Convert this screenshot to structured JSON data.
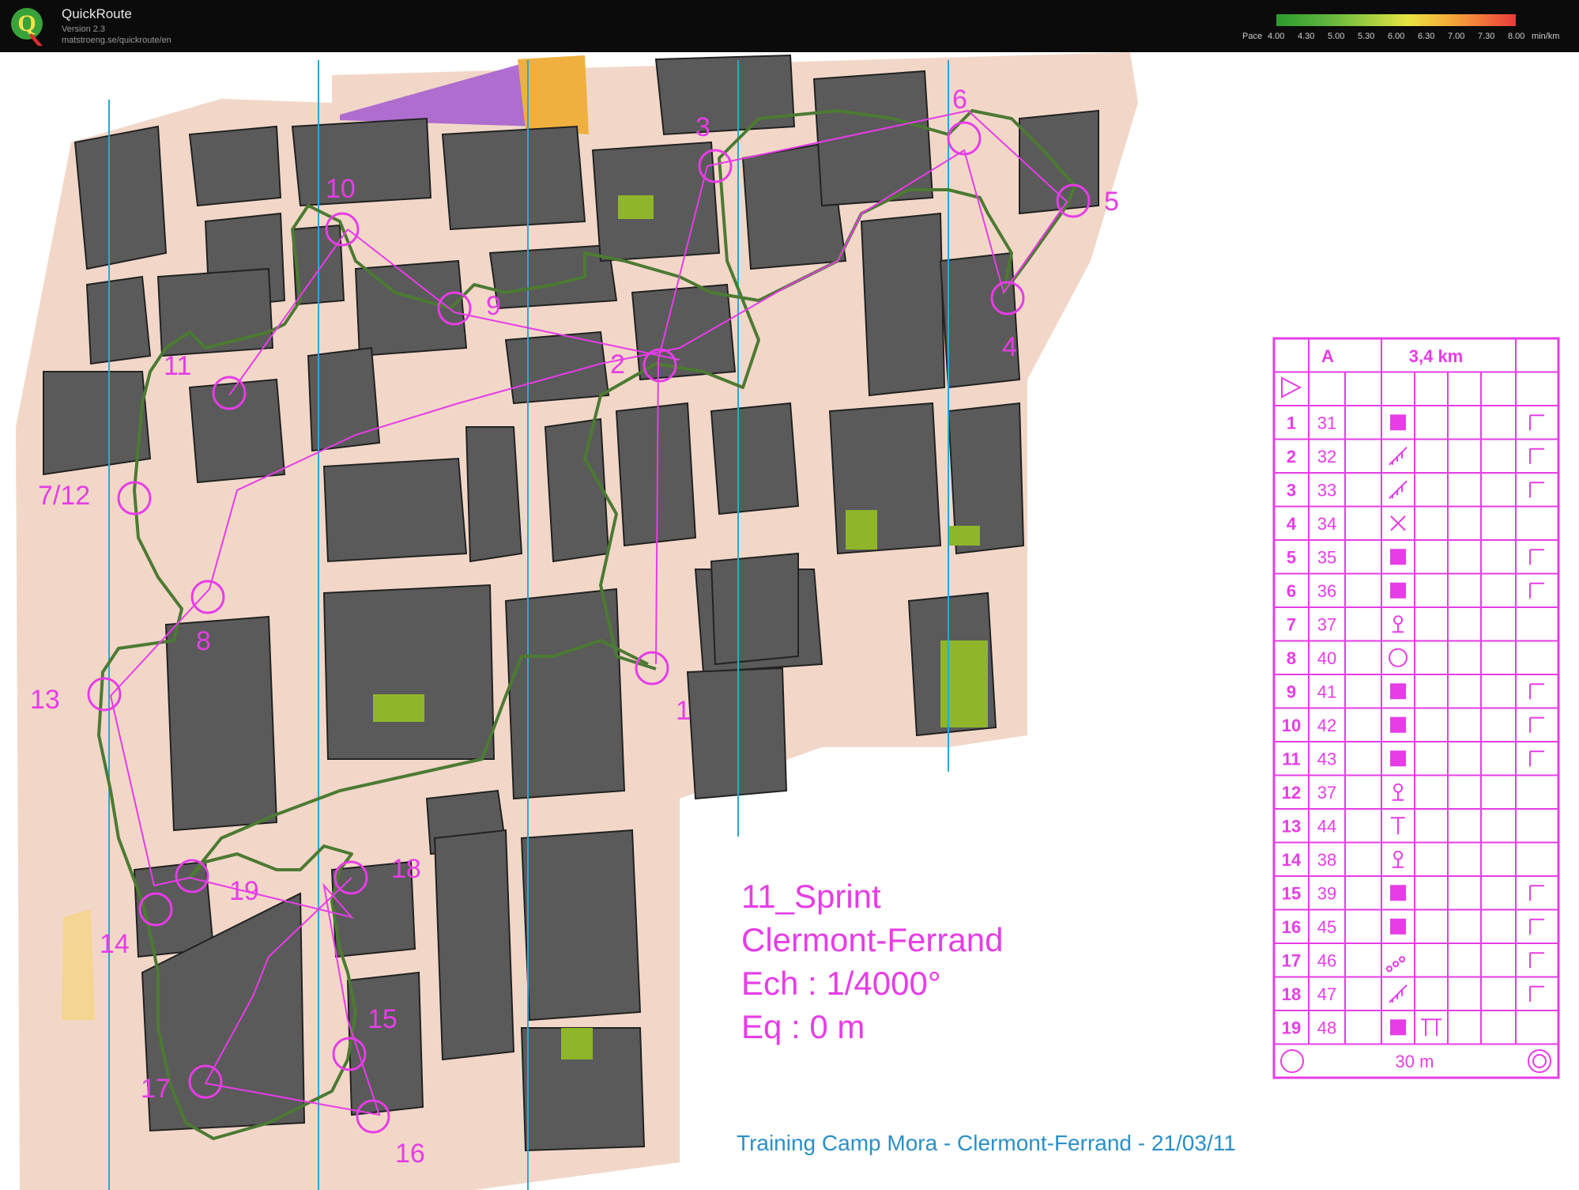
{
  "app": {
    "name": "QuickRoute",
    "version": "Version 2.3",
    "url": "matstroeng.se/quickroute/en",
    "logo_letter": "Q"
  },
  "pace_legend": {
    "label": "Pace",
    "ticks": [
      "4.00",
      "4.30",
      "5.00",
      "5.30",
      "6.00",
      "6.30",
      "7.00",
      "7.30",
      "8.00"
    ],
    "unit": "min/km",
    "colors": {
      "fast": "#2c9a2c",
      "mid": "#e8e444",
      "slow": "#ea3a3a"
    }
  },
  "map": {
    "colors": {
      "building": "#5a5a5a",
      "paved": "#f2d7c8",
      "control": "#e63de6",
      "route": "#4c7a33",
      "meridian": "#2aa7d6",
      "green": "#8fb52a"
    },
    "event_title": {
      "line1": "11_Sprint",
      "line2": "Clermont-Ferrand",
      "line3": "Ech : 1/4000°",
      "line4": "Eq : 0 m"
    },
    "footer": "Training Camp Mora - Clermont-Ferrand - 21/03/11",
    "controls": [
      {
        "label": "1"
      },
      {
        "label": "2"
      },
      {
        "label": "3"
      },
      {
        "label": "4"
      },
      {
        "label": "5"
      },
      {
        "label": "6"
      },
      {
        "label": "7/12"
      },
      {
        "label": "8"
      },
      {
        "label": "9"
      },
      {
        "label": "10"
      },
      {
        "label": "11"
      },
      {
        "label": "13"
      },
      {
        "label": "14"
      },
      {
        "label": "15"
      },
      {
        "label": "16"
      },
      {
        "label": "17"
      },
      {
        "label": "18"
      },
      {
        "label": "19"
      }
    ]
  },
  "description_sheet": {
    "class": "A",
    "length": "3,4 km",
    "rows": [
      {
        "no": "1",
        "code": "31",
        "symbol": "square",
        "extra": "corner-inside"
      },
      {
        "no": "2",
        "code": "32",
        "symbol": "stairs",
        "extra": "side"
      },
      {
        "no": "3",
        "code": "33",
        "symbol": "stairs",
        "extra": "side"
      },
      {
        "no": "4",
        "code": "34",
        "symbol": "cross",
        "extra": ""
      },
      {
        "no": "5",
        "code": "35",
        "symbol": "square",
        "extra": "corner-outside"
      },
      {
        "no": "6",
        "code": "36",
        "symbol": "square",
        "extra": "corner-low"
      },
      {
        "no": "7",
        "code": "37",
        "symbol": "statue",
        "extra": ""
      },
      {
        "no": "8",
        "code": "40",
        "symbol": "circle",
        "extra": ""
      },
      {
        "no": "9",
        "code": "41",
        "symbol": "square",
        "extra": "corner-inside"
      },
      {
        "no": "10",
        "code": "42",
        "symbol": "square",
        "extra": "corner-outside"
      },
      {
        "no": "11",
        "code": "43",
        "symbol": "square",
        "extra": "corner-outside"
      },
      {
        "no": "12",
        "code": "37",
        "symbol": "statue",
        "extra": ""
      },
      {
        "no": "13",
        "code": "44",
        "symbol": "tee",
        "extra": ""
      },
      {
        "no": "14",
        "code": "38",
        "symbol": "statue",
        "extra": ""
      },
      {
        "no": "15",
        "code": "39",
        "symbol": "square",
        "extra": "check"
      },
      {
        "no": "16",
        "code": "45",
        "symbol": "square",
        "extra": "corner-bottom"
      },
      {
        "no": "17",
        "code": "46",
        "symbol": "dots",
        "extra": "side"
      },
      {
        "no": "18",
        "code": "47",
        "symbol": "stairs",
        "extra": "corner-low"
      },
      {
        "no": "19",
        "code": "48",
        "symbol": "square",
        "extra": "pi"
      }
    ],
    "finish": "30 m"
  }
}
